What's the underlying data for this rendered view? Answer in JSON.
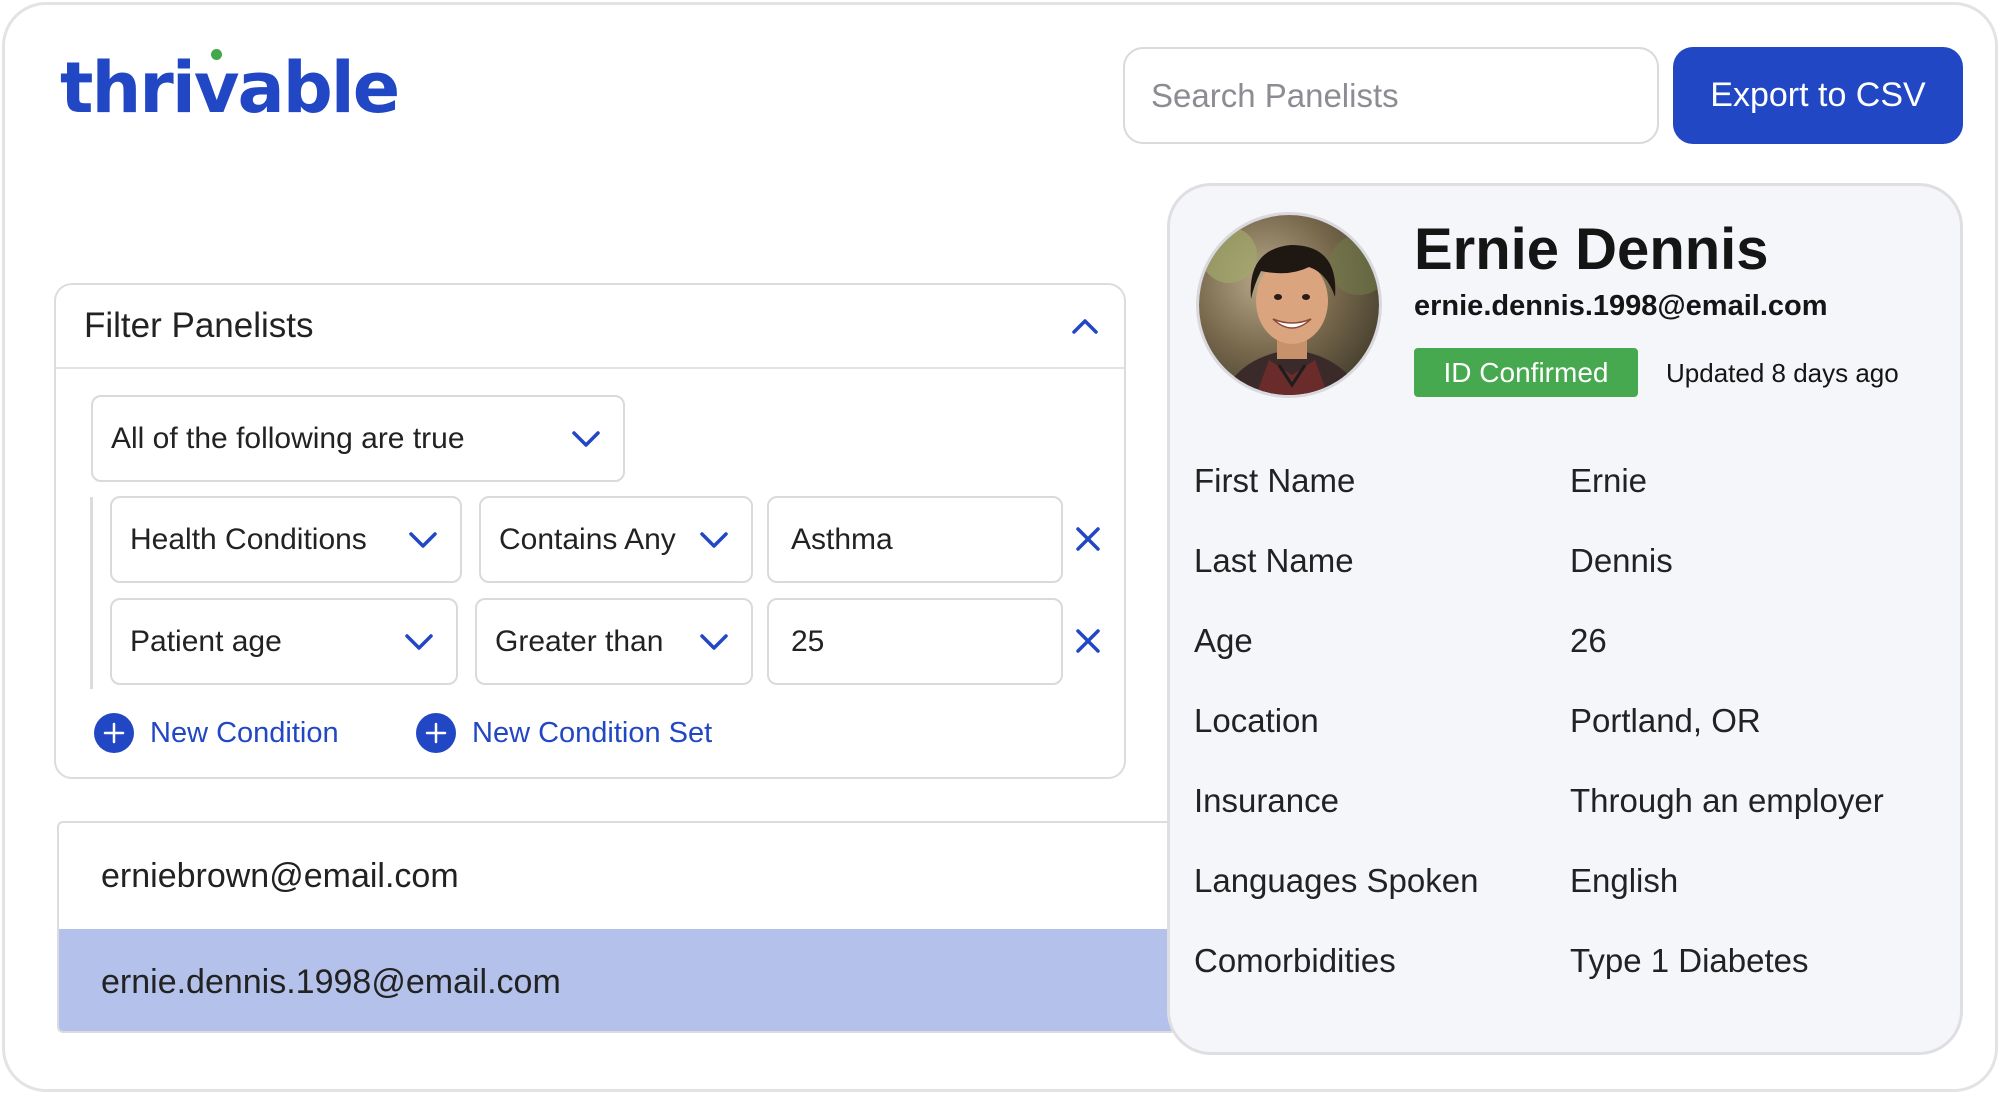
{
  "brand": {
    "logo_text_pre": "thri",
    "logo_text_v": "v",
    "logo_text_post": "able",
    "accent_color": "#2247c4",
    "dot_color": "#43a84a"
  },
  "header": {
    "search_placeholder": "Search Panelists",
    "export_label": "Export to CSV"
  },
  "filter": {
    "title": "Filter Panelists",
    "logic_select": "All of the following are true",
    "conditions": [
      {
        "field": "Health Conditions",
        "operator": "Contains Any",
        "value": "Asthma"
      },
      {
        "field": "Patient age",
        "operator": "Greater than",
        "value": "25"
      }
    ],
    "add_condition_label": "New Condition",
    "add_condition_set_label": "New Condition Set"
  },
  "results": [
    {
      "email": "erniebrown@email.com",
      "selected": false
    },
    {
      "email": "ernie.dennis.1998@email.com",
      "selected": true
    }
  ],
  "profile": {
    "name": "Ernie Dennis",
    "email": "ernie.dennis.1998@email.com",
    "status_badge": "ID Confirmed",
    "status_color": "#46a84f",
    "updated": "Updated 8 days ago",
    "fields": [
      {
        "label": "First Name",
        "value": "Ernie"
      },
      {
        "label": "Last Name",
        "value": "Dennis"
      },
      {
        "label": "Age",
        "value": "26"
      },
      {
        "label": "Location",
        "value": "Portland, OR"
      },
      {
        "label": "Insurance",
        "value": "Through an employer"
      },
      {
        "label": "Languages Spoken",
        "value": "English"
      },
      {
        "label": "Comorbidities",
        "value": "Type 1 Diabetes"
      }
    ]
  }
}
